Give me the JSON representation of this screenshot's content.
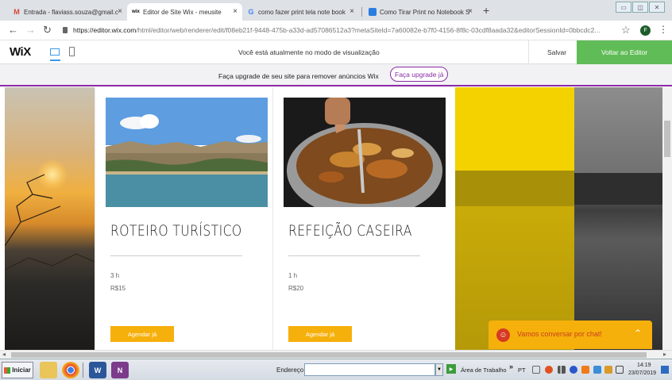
{
  "browser": {
    "tabs": [
      {
        "label": "Entrada - flaviass.souza@gmail.c",
        "icon": "gmail-icon"
      },
      {
        "label": "Editor de Site Wix - meusite",
        "icon": "wix-icon"
      },
      {
        "label": "como fazer print tela note book",
        "icon": "google-icon"
      },
      {
        "label": "Como Tirar Print no Notebook S",
        "icon": "bookmark-icon"
      }
    ],
    "new_tab": "+",
    "close_glyph": "×",
    "url_host": "https://editor.wix.com",
    "url_path": "/html/editor/web/renderer/edit/f08eb21f-9448-475b-a33d-ad57086512a3?metaSiteId=7a60082e-b7f0-4156-8f8c-03cdf8aada32&editorSessionId=0bbcdc2...",
    "profile_initial": "F"
  },
  "wix_bar": {
    "logo": "WiX",
    "preview_message": "Você está atualmente no modo de visualização",
    "save_label": "Salvar",
    "back_label": "Voltar ao Editor"
  },
  "upgrade_banner": {
    "message": "Faça upgrade de seu site para remover anúncios Wix",
    "link": "Faça upgrade já"
  },
  "services": [
    {
      "title": "ROTEIRO TURÍSTICO",
      "duration": "3 h",
      "price": "R$15",
      "button": "Agendar já"
    },
    {
      "title": "REFEIÇÃO CASEIRA",
      "duration": "1 h",
      "price": "R$20",
      "button": "Agendar já"
    }
  ],
  "chat": {
    "label": "Vamos conversar por chat!"
  },
  "taskbar": {
    "start": "Iniciar",
    "address_label": "Endereço",
    "desktop_label": "Área de Trabalho",
    "more": "»",
    "language": "PT",
    "time": "14:19",
    "date": "23/07/2019"
  },
  "colors": {
    "accent_green": "#60bc57",
    "upgrade_purple": "#8b2aa7",
    "button_yellow": "#f6b00b"
  }
}
